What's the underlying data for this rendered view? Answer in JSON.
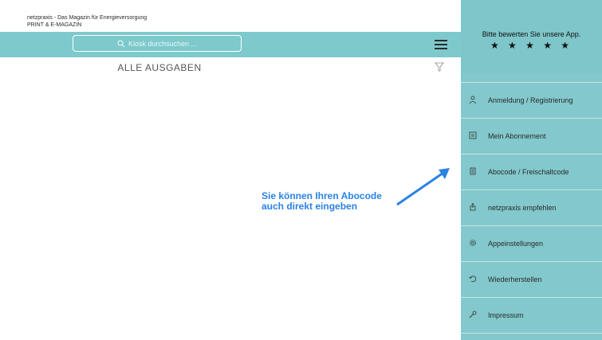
{
  "header": {
    "magazine_line1": "netzpraxis - Das Magazin für Energieversorgung",
    "magazine_line2": "PRINT & E-MAGAZIN"
  },
  "toolbar": {
    "search_placeholder": "Kiosk durchsuchen ..."
  },
  "main": {
    "section_title": "ALLE AUSGABEN"
  },
  "annotation": {
    "line1": "Sie können Ihren Abocode",
    "line2": "auch direkt eingeben"
  },
  "sidebar": {
    "rate_text": "Bitte bewerten Sie unsere App.",
    "stars": "★ ★ ★ ★ ★",
    "items": [
      {
        "label": "Anmeldung / Registrierung",
        "icon": "user-icon"
      },
      {
        "label": "Mein Abonnement",
        "icon": "subscription-icon"
      },
      {
        "label": "Abocode / Freischaltcode",
        "icon": "code-icon"
      },
      {
        "label": "netzpraxis empfehlen",
        "icon": "share-icon"
      },
      {
        "label": "Appeinstellungen",
        "icon": "settings-icon"
      },
      {
        "label": "Wiederherstellen",
        "icon": "restore-icon"
      },
      {
        "label": "Impressum",
        "icon": "info-icon"
      }
    ]
  },
  "colors": {
    "accent": "#7dc9cc",
    "annotation": "#2a82e4"
  }
}
